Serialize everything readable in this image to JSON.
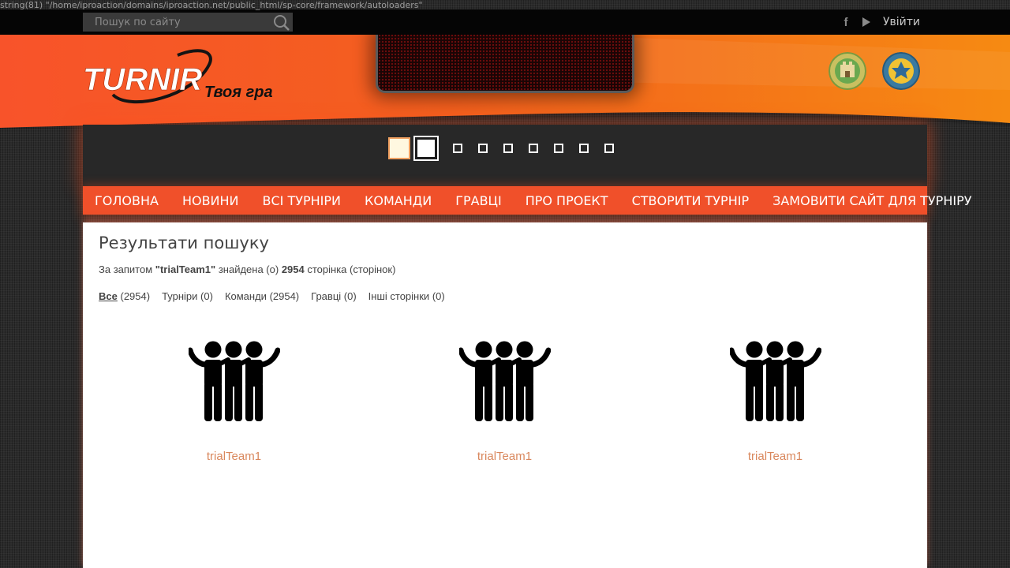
{
  "debug_text": "string(81) \"/home/iproaction/domains/iproaction.net/public_html/sp-core/framework/autoloaders\"",
  "topbar": {
    "search_placeholder": "Пошук по сайту",
    "login_label": "Увійти",
    "social": {
      "facebook_glyph": "f"
    }
  },
  "header": {
    "logo_text": "TURNIR",
    "slogan": "Твоя гра"
  },
  "banner": {
    "slide_count": 9,
    "active_slide": 2
  },
  "nav": {
    "items": [
      {
        "label": "ГОЛОВНА"
      },
      {
        "label": "НОВИНИ"
      },
      {
        "label": "ВСІ ТУРНІРИ"
      },
      {
        "label": "КОМАНДИ"
      },
      {
        "label": "ГРАВЦІ"
      },
      {
        "label": "ПРО ПРОЕКТ"
      },
      {
        "label": "СТВОРИТИ ТУРНІР"
      },
      {
        "label": "ЗАМОВИТИ САЙТ ДЛЯ ТУРНІРУ"
      }
    ]
  },
  "search_results": {
    "title": "Результати пошуку",
    "query_prefix": "За запитом",
    "query": "\"trialTeam1\"",
    "query_middle": "знайдена (о)",
    "count": "2954",
    "query_suffix": "сторінка (сторінок)",
    "filters": [
      {
        "label": "Все",
        "count": "(2954)",
        "active": true
      },
      {
        "label": "Турніри",
        "count": "(0)"
      },
      {
        "label": "Команди",
        "count": "(2954)"
      },
      {
        "label": "Гравці",
        "count": "(0)"
      },
      {
        "label": "Інші сторінки",
        "count": "(0)"
      }
    ],
    "items": [
      {
        "name": "trialTeam1",
        "icon": "team-icon"
      },
      {
        "name": "trialTeam1",
        "icon": "team-icon"
      },
      {
        "name": "trialTeam1",
        "icon": "team-icon"
      }
    ]
  },
  "colors": {
    "accent": "#f0502a",
    "link": "#d9875c",
    "topbar": "#050505"
  }
}
